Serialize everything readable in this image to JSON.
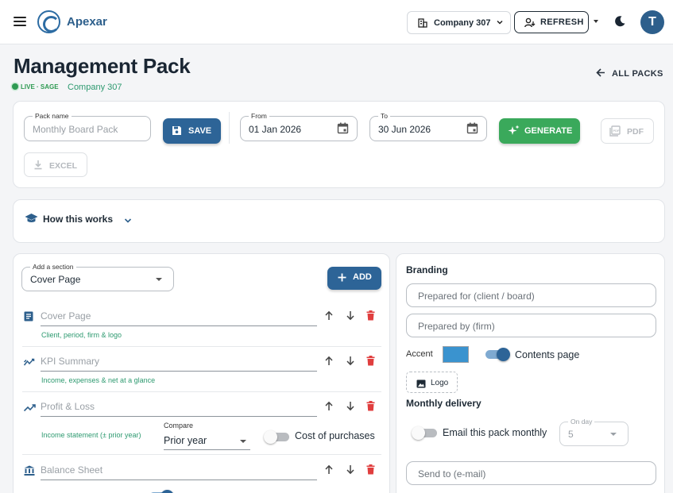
{
  "app": {
    "name": "Apexar",
    "user_initial": "T"
  },
  "topbar": {
    "company": "Company 307",
    "refresh_label": "REFRESH",
    "icons": [
      "menu-icon",
      "building-icon",
      "chevron-down-icon",
      "refresh-user-icon",
      "caret-down-icon",
      "moon-icon"
    ]
  },
  "header": {
    "title": "Management Pack",
    "live_badge": "LIVE · SAGE",
    "company": "Company 307",
    "all_packs_label": "ALL PACKS"
  },
  "toolbar": {
    "pack_name_label": "Pack name",
    "pack_name_placeholder": "Monthly Board Pack",
    "save_label": "SAVE",
    "from_label": "From",
    "from_value": "01 Jan 2026",
    "to_label": "To",
    "to_value": "30 Jun 2026",
    "generate_label": "GENERATE",
    "pdf_label": "PDF",
    "excel_label": "EXCEL"
  },
  "how_it_works": {
    "label": "How this works"
  },
  "sections": {
    "add_label": "Add a section",
    "add_value": "Cover Page",
    "add_button": "ADD",
    "compare_label": "Compare",
    "compare_value": "Prior year",
    "cost_of_purchases_label": "Cost of purchases",
    "items": [
      {
        "name": "Cover Page",
        "sub": "Client, period, firm & logo",
        "icon": "document-icon"
      },
      {
        "name": "KPI Summary",
        "sub": "Income, expenses & net at a glance",
        "icon": "trend-icon"
      },
      {
        "name": "Profit & Loss",
        "sub": "Income statement (± prior year)",
        "icon": "trend-up-icon"
      },
      {
        "name": "Balance Sheet",
        "sub": "",
        "icon": "bank-icon"
      }
    ]
  },
  "branding": {
    "title": "Branding",
    "prepared_for_placeholder": "Prepared for (client / board)",
    "prepared_by_placeholder": "Prepared by (firm)",
    "accent_label": "Accent",
    "accent_color": "#3a93cf",
    "contents_page_label": "Contents page",
    "contents_page_on": true,
    "logo_label": "Logo"
  },
  "delivery": {
    "title": "Monthly delivery",
    "email_label": "Email this pack monthly",
    "email_on": false,
    "on_day_label": "On day",
    "on_day_value": "5",
    "send_to_placeholder": "Send to (e-mail)"
  },
  "colors": {
    "primary": "#2d6497",
    "green": "#3aa95b",
    "teal": "#2e9a70",
    "danger": "#e03e3e"
  }
}
